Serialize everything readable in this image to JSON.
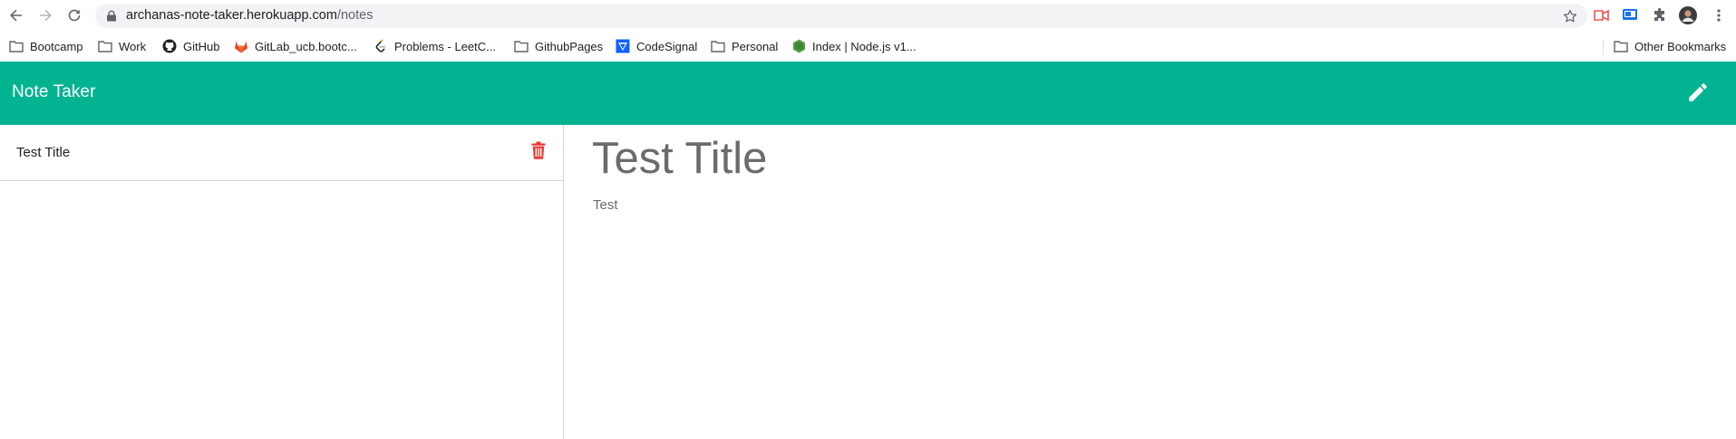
{
  "browser": {
    "url_host": "archanas-note-taker.herokuapp.com",
    "url_path": "/notes",
    "icons": {
      "back": "back-arrow-icon",
      "forward": "forward-arrow-icon",
      "reload": "reload-icon",
      "lock": "lock-icon",
      "star": "star-icon",
      "extensions": "puzzle-icon",
      "menu": "kebab-menu-icon"
    },
    "bookmarks": [
      {
        "label": "Bootcamp",
        "icon": "folder-icon"
      },
      {
        "label": "Work",
        "icon": "folder-icon"
      },
      {
        "label": "GitHub",
        "icon": "github-icon"
      },
      {
        "label": "GitLab_ucb.bootc...",
        "icon": "gitlab-icon"
      },
      {
        "label": "Problems - LeetC...",
        "icon": "leetcode-icon"
      },
      {
        "label": "GithubPages",
        "icon": "folder-icon"
      },
      {
        "label": "CodeSignal",
        "icon": "codesignal-icon"
      },
      {
        "label": "Personal",
        "icon": "folder-icon"
      },
      {
        "label": "Index | Node.js v1...",
        "icon": "nodejs-icon"
      }
    ],
    "other_bookmarks": "Other Bookmarks"
  },
  "app": {
    "brand": "Note Taker",
    "accent_color": "#01b391",
    "new_note_icon": "pencil-icon",
    "notes": [
      {
        "title": "Test Title",
        "delete_icon": "trash-icon"
      }
    ],
    "active_note": {
      "title": "Test Title",
      "text": "Test"
    }
  }
}
